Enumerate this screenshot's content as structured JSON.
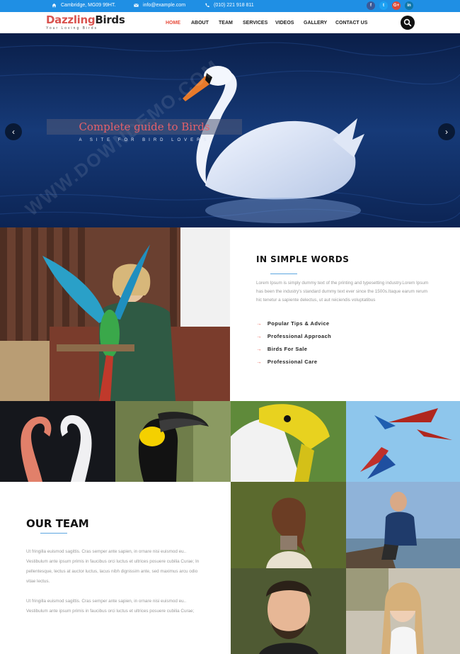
{
  "topbar": {
    "address": "Cambridge, MG09 99HT.",
    "email": "info@example.com",
    "phone": "(010) 221 918 811",
    "social": [
      {
        "name": "facebook-icon",
        "glyph": "f",
        "color": "#3b5998"
      },
      {
        "name": "twitter-icon",
        "glyph": "t",
        "color": "#1da1f2"
      },
      {
        "name": "google-plus-icon",
        "glyph": "G+",
        "color": "#dd4b39"
      },
      {
        "name": "linkedin-icon",
        "glyph": "in",
        "color": "#0e76a8"
      }
    ]
  },
  "brand": {
    "name_part1": "Dazzling",
    "name_part2": "Birds",
    "tagline": "Your Loving Birds"
  },
  "nav": {
    "items": [
      "HOME",
      "ABOUT",
      "TEAM",
      "SERVICES",
      "VIDEOS",
      "GALLERY",
      "CONTACT US"
    ],
    "active": "HOME"
  },
  "hero": {
    "title": "Complete guide to Birds",
    "subtitle": "A SITE FOR BIRD LOVERS",
    "prev_glyph": "‹",
    "next_glyph": "›"
  },
  "about": {
    "title": "IN SIMPLE WORDS",
    "paragraph": "Lorem Ipsum is simply dummy text of the printing and typesetting industry.Lorem Ipsum has been the industry's standard dummy text ever since the 1500s.Itaque earum rerum hic tenetur a sapiente delectus, ut aut reiciendis voluptatibus",
    "features": [
      "Popular Tips & Advice",
      "Professional Approach",
      "Birds For Sale",
      "Professional Care"
    ],
    "arrow_glyph": "→"
  },
  "team": {
    "title": "OUR TEAM",
    "paragraph1": "Ut fringilla euismod sagittis. Cras semper ante sapien, in ornare nisi euismod eu.. Vestibulum ante ipsum primis in faucibus orci luctus et ultrices posuere cubilia Curae; In pellentesque, lectus at auctor luctus, lacus nibh dignissim ante, sed maximus arcu odio vitae lectus.",
    "paragraph2": "Ut fringilla euismod sagittis. Cras semper ante sapien, in ornare nisi euismod eu.. Vestibulum ante ipsum primis in faucibus orci luctus et ultrices posuere cubilia Curae;"
  },
  "watermark": "WWW.DOWNDEMO.COM",
  "colors": {
    "topbar": "#1f8fe4",
    "accent": "#e74c3c",
    "underline": "#5da6e0"
  }
}
